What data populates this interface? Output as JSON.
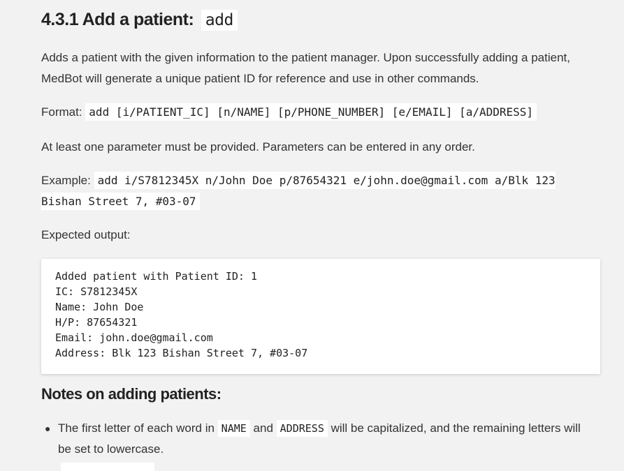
{
  "heading": {
    "text": "4.3.1 Add a patient:",
    "code": "add"
  },
  "description": "Adds a patient with the given information to the patient manager. Upon successfully adding a patient, MedBot will generate a unique patient ID for reference and use in other commands.",
  "format": {
    "label": "Format:",
    "code": "add [i/PATIENT_IC] [n/NAME] [p/PHONE_NUMBER] [e/EMAIL] [a/ADDRESS]"
  },
  "parameter_note": "At least one parameter must be provided. Parameters can be entered in any order.",
  "example": {
    "label": "Example:",
    "code": "add i/S7812345X n/John Doe p/87654321 e/john.doe@gmail.com a/Blk 123 Bishan Street 7, #03-07"
  },
  "expected_label": "Expected output:",
  "expected_output": "Added patient with Patient ID: 1\nIC: S7812345X\nName: John Doe\nH/P: 87654321\nEmail: john.doe@gmail.com\nAddress: Blk 123 Bishan Street 7, #03-07",
  "notes": {
    "title": "Notes on adding patients:",
    "items": [
      {
        "pre": "The first letter of each word in",
        "code1": "NAME",
        "mid": "and",
        "code2": "ADDRESS",
        "post": "will be capitalized, and the remaining letters will be set to lowercase."
      }
    ]
  }
}
